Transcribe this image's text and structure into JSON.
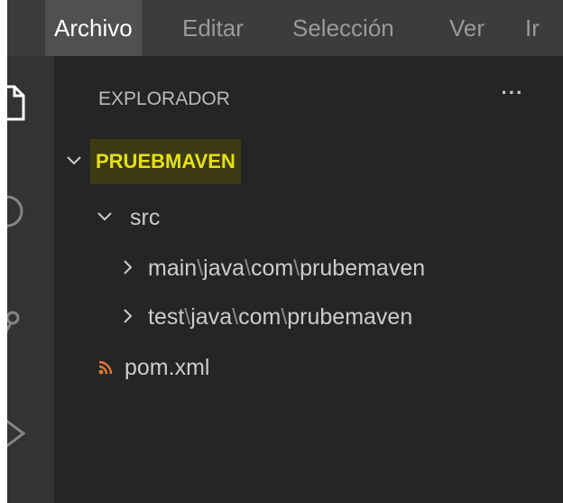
{
  "menubar": {
    "items": [
      {
        "label": "Archivo",
        "active": true
      },
      {
        "label": "Editar"
      },
      {
        "label": "Selección"
      },
      {
        "label": "Ver"
      },
      {
        "label": "Ir"
      }
    ]
  },
  "activitybar": {
    "icons": [
      "explorer-files-icon",
      "search-icon",
      "source-control-icon",
      "run-debug-icon"
    ]
  },
  "explorer": {
    "title": "EXPLORADOR",
    "more_label": "···",
    "tree": {
      "root": {
        "label": "PRUEBMAVEN",
        "expanded": true
      },
      "src": {
        "label": "src",
        "expanded": true
      },
      "main": {
        "parts": [
          "main",
          "java",
          "com",
          "prubemaven"
        ],
        "separator": "\\"
      },
      "test": {
        "parts": [
          "test",
          "java",
          "com",
          "prubemaven"
        ],
        "separator": "\\"
      },
      "pom": {
        "label": "pom.xml",
        "icon": "rss-feed-icon"
      }
    }
  },
  "colors": {
    "menubar_bg": "#3c3c3c",
    "activitybar_bg": "#333333",
    "sidebar_bg": "#252526",
    "root_highlight_bg": "#3d3b12",
    "root_text": "#e5e10f",
    "xml_icon": "#e37933"
  }
}
